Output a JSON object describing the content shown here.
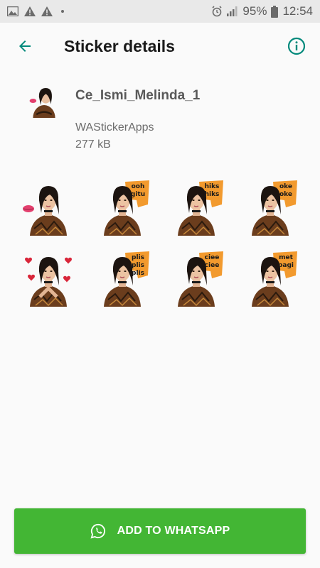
{
  "status_bar": {
    "battery_percent": "95%",
    "time": "12:54",
    "icons": [
      "image-icon",
      "warning-icon",
      "warning-icon",
      "dot-icon",
      "alarm-icon",
      "signal-icon",
      "battery-icon"
    ]
  },
  "app_bar": {
    "title": "Sticker details",
    "back_icon": "arrow-back-icon",
    "info_icon": "info-icon",
    "accent_color": "#00897b"
  },
  "pack": {
    "name": "Ce_Ismi_Melinda_1",
    "publisher": "WAStickerApps",
    "size": "277 kB"
  },
  "stickers": [
    {
      "caption": "",
      "decor": "kiss-lips"
    },
    {
      "caption": "ooh gitu",
      "decor": "orange-bubble"
    },
    {
      "caption": "hiks hiks",
      "decor": "orange-bubble"
    },
    {
      "caption": "oke oke",
      "decor": "orange-bubble"
    },
    {
      "caption": "",
      "decor": "hearts"
    },
    {
      "caption": "plis plis plis",
      "decor": "orange-bubble"
    },
    {
      "caption": "ciee ciee",
      "decor": "orange-bubble"
    },
    {
      "caption": "met pagi",
      "decor": "orange-bubble"
    }
  ],
  "add_button": {
    "label": "ADD TO WHATSAPP",
    "icon": "whatsapp-icon",
    "color": "#43b634"
  }
}
